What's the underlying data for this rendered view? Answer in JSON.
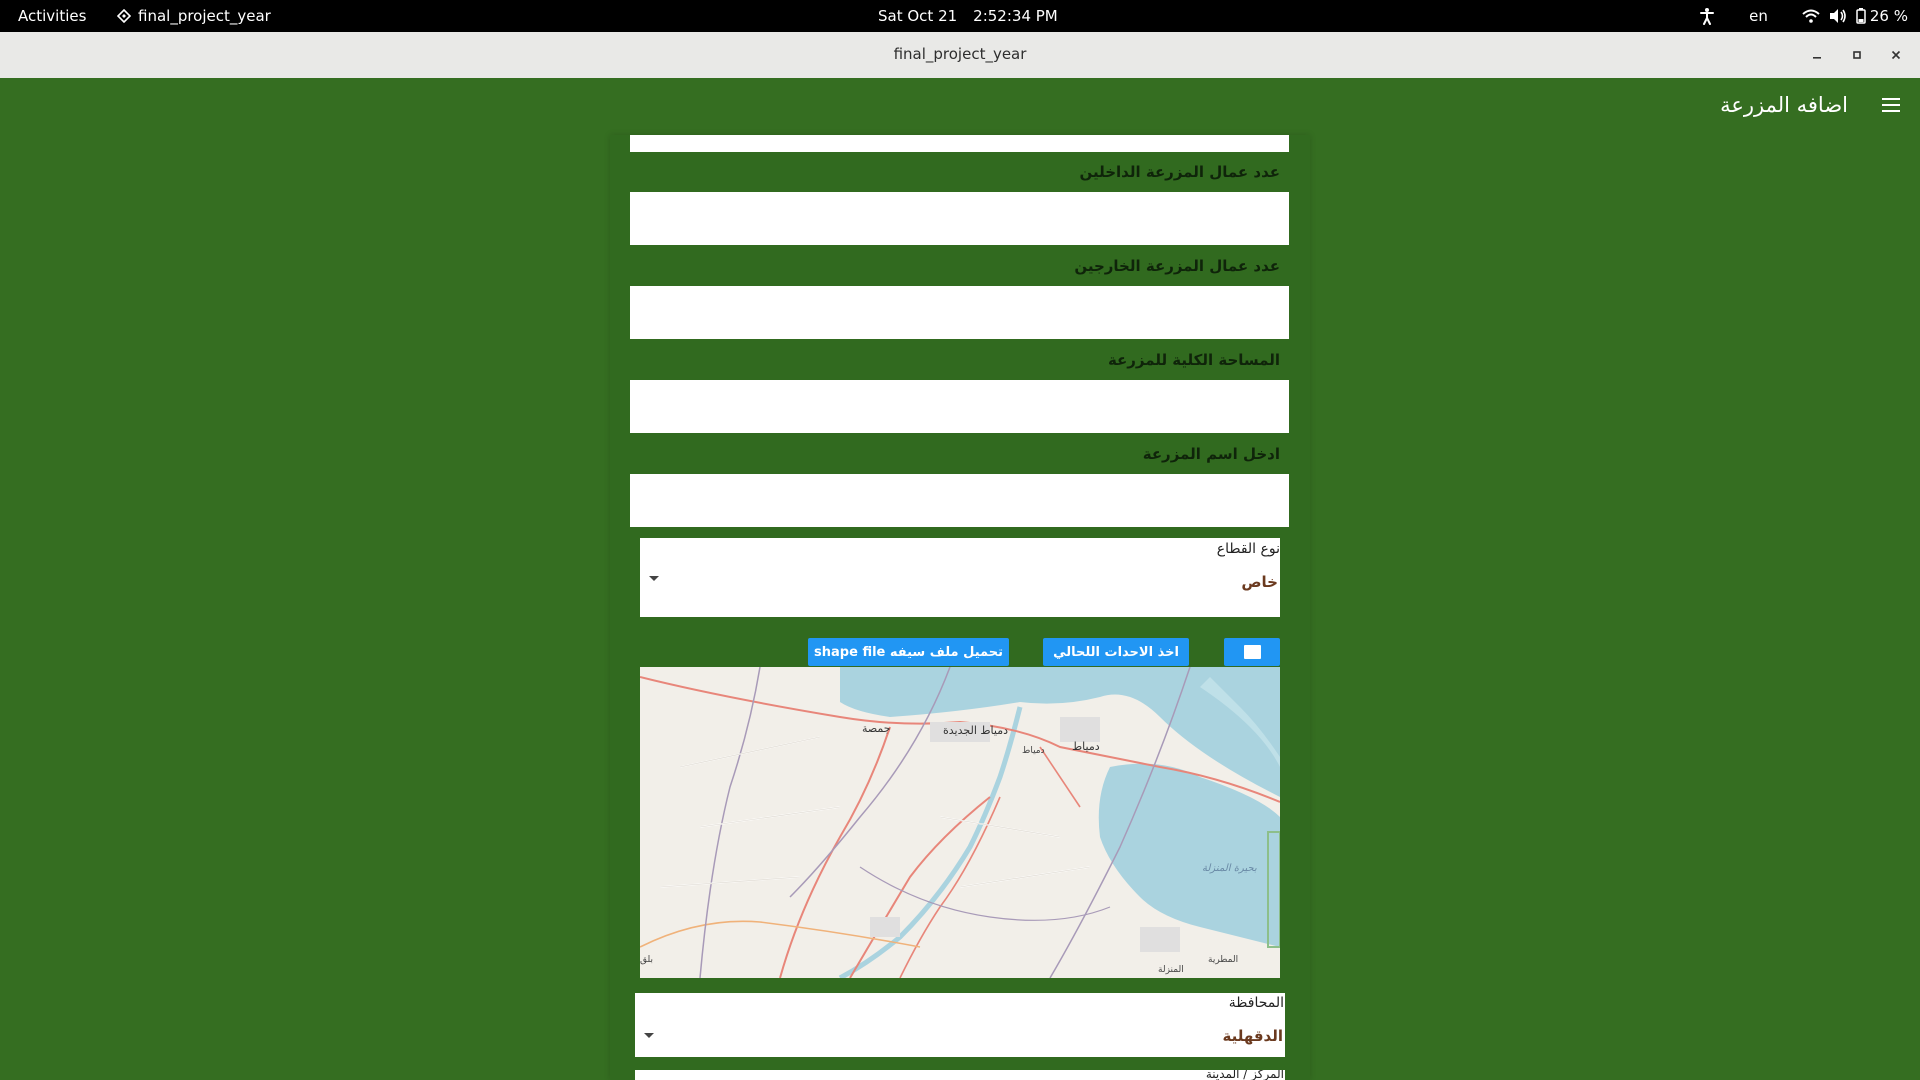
{
  "system_bar": {
    "activities": "Activities",
    "app_name": "final_project_year",
    "date": "Sat Oct 21",
    "time": "2:52:34 PM",
    "language": "en",
    "battery": "26 %"
  },
  "window": {
    "title": "final_project_year"
  },
  "appbar": {
    "title": "اضافه المزرعة"
  },
  "form": {
    "internal_workers_label": "عدد عمال المزرعة الداخلين",
    "internal_workers_value": "",
    "external_workers_label": "عدد عمال المزرعة الخارجين",
    "external_workers_value": "",
    "total_area_label": "المساحة الكلية للمزرعة",
    "total_area_value": "",
    "farm_name_label": "ادخل اسم المزرعة",
    "farm_name_value": "",
    "sector_type": {
      "label": "نوع القطاع",
      "value": "خاص"
    },
    "upload_shapefile_button": "تحميل ملف سيفه shape file",
    "current_location_button": "اخذ الاحدات اللحالي",
    "checkbox_checked": false,
    "governorate": {
      "label": "المحافظة",
      "value": "الدقهلية"
    },
    "next_field_label": "المركز / المدينة"
  },
  "map": {
    "places": {
      "gamasa": "جمصة",
      "new_damietta": "دمياط الجديدة",
      "damietta_1": "دمياط",
      "damietta_2": "دمياط",
      "manzala_lake": "بحيرة المنزلة",
      "matariya": "المطرية",
      "manzala": "المنزلة",
      "left_edge": "بلق"
    },
    "colors": {
      "land": "#f2efe9",
      "water": "#aad3df",
      "primary_road": "#e8867a",
      "boundary": "#a89ab8"
    }
  }
}
